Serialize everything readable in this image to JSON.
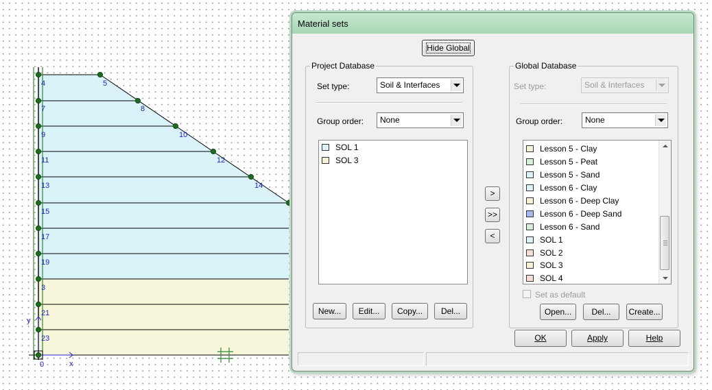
{
  "canvas": {
    "node_labels": [
      "4",
      "5",
      "7",
      "8",
      "9",
      "10",
      "11",
      "12",
      "13",
      "14",
      "15",
      "17",
      "19",
      "3",
      "21",
      "23",
      "0"
    ],
    "axis_labels": {
      "x": "x",
      "y": "y"
    },
    "colors": {
      "soil_upper": "#daf3f8",
      "soil_lower": "#f7f6da",
      "line": "#000000",
      "node": "#1a6d1a",
      "label": "#2222cc"
    }
  },
  "dialog": {
    "title": "Material sets",
    "hide_global_label": "Hide Global",
    "project": {
      "group_title": "Project Database",
      "set_type_label": "Set type:",
      "set_type_value": "Soil & Interfaces",
      "group_order_label": "Group order:",
      "group_order_value": "None",
      "items": [
        {
          "name": "SOL 1",
          "color": "#dcf4f8"
        },
        {
          "name": "SOL 3",
          "color": "#f8f2d4"
        }
      ],
      "buttons": {
        "new": "New...",
        "edit": "Edit...",
        "copy": "Copy...",
        "del": "Del..."
      }
    },
    "transfer": {
      "copy_one": ">",
      "copy_all": ">>",
      "copy_back": "<"
    },
    "global": {
      "group_title": "Global Database",
      "set_type_label": "Set type:",
      "set_type_value": "Soil & Interfaces",
      "group_order_label": "Group order:",
      "group_order_value": "None",
      "items": [
        {
          "name": "Lesson 5 - Clay",
          "color": "#f8f2d4"
        },
        {
          "name": "Lesson 5 - Peat",
          "color": "#d4f0d8"
        },
        {
          "name": "Lesson 5 - Sand",
          "color": "#dcf4f8"
        },
        {
          "name": "Lesson 6 - Clay",
          "color": "#dcf4f8"
        },
        {
          "name": "Lesson 6 - Deep Clay",
          "color": "#f8f2d4"
        },
        {
          "name": "Lesson 6 - Deep Sand",
          "color": "#a8b8f0"
        },
        {
          "name": "Lesson 6 - Sand",
          "color": "#d4f0d8"
        },
        {
          "name": "SOL 1",
          "color": "#dcf4f8"
        },
        {
          "name": "SOL 2",
          "color": "#f8dcd8"
        },
        {
          "name": "SOL 3",
          "color": "#f8f2d4"
        },
        {
          "name": "SOL 4",
          "color": "#f8dcd8"
        }
      ],
      "set_default_label": "Set as default",
      "buttons": {
        "open": "Open...",
        "del": "Del...",
        "create": "Create..."
      }
    },
    "footer": {
      "ok": "OK",
      "apply": "Apply",
      "help": "Help"
    }
  }
}
